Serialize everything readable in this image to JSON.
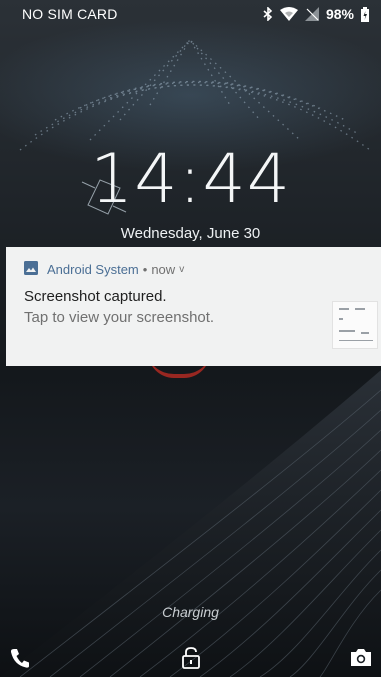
{
  "status_bar": {
    "carrier": "NO SIM CARD",
    "battery_percent": "98%",
    "icons": [
      "bluetooth-icon",
      "wifi-icon",
      "no-sim-icon",
      "battery-icon"
    ]
  },
  "lock_screen": {
    "time": "14:44",
    "date": "Wednesday, June 30",
    "charging_text": "Charging"
  },
  "notification": {
    "app_name": "Android System",
    "separator": "•",
    "time": "now",
    "expand_glyph": "v",
    "title": "Screenshot captured.",
    "text": "Tap to view your screenshot.",
    "icon": "image-icon"
  },
  "bottom_bar": {
    "left": "phone-icon",
    "center": "lock-icon",
    "right": "camera-icon"
  },
  "colors": {
    "notification_bg": "#f1f2f2",
    "accent_app_name": "#4b6f95",
    "background": "#1f2429"
  }
}
